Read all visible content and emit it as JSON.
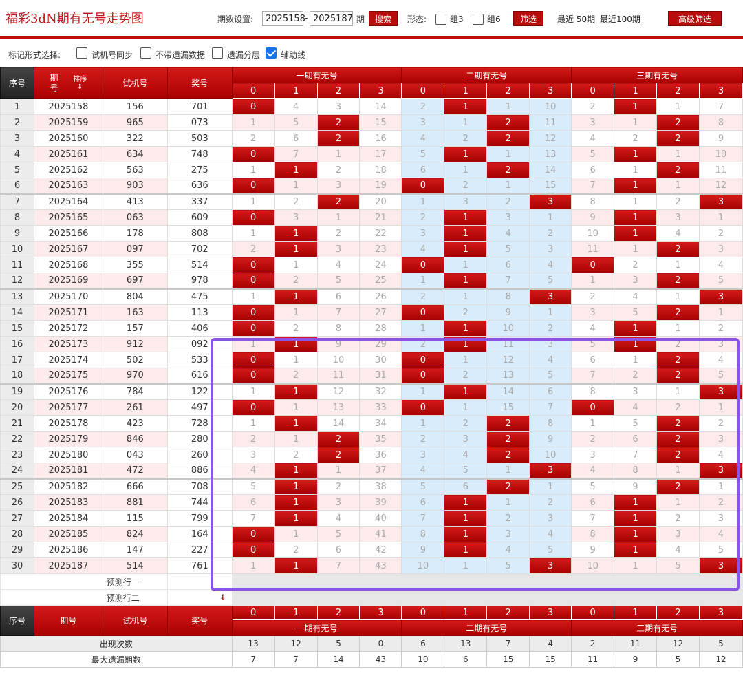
{
  "header": {
    "title": "福彩3dN期有无号走势图",
    "period_label": "期数设置:",
    "from_value": "2025158",
    "to_value": "2025187",
    "period_unit": "期",
    "search_label": "搜索",
    "form_label": "形态:",
    "group3_label": "组3",
    "group6_label": "组6",
    "filter_label": "筛选",
    "recent50_label": "最近 50期",
    "recent100_label": "最近100期",
    "advanced_label": "高级筛选"
  },
  "markbar": {
    "label": "标记形式选择:",
    "options": [
      {
        "label": "试机号同步",
        "checked": false
      },
      {
        "label": "不带遗漏数据",
        "checked": false
      },
      {
        "label": "遗漏分层",
        "checked": false
      },
      {
        "label": "辅助线",
        "checked": true
      }
    ]
  },
  "table": {
    "headers": {
      "seq": "序号",
      "period": "期号",
      "sort": "排序",
      "trial": "试机号",
      "prize": "奖号"
    },
    "groups": [
      "一期有无号",
      "二期有无号",
      "三期有无号"
    ],
    "digits": [
      "0",
      "1",
      "2",
      "3"
    ],
    "rows": [
      {
        "seq": "1",
        "period": "2025158",
        "trial": "156",
        "prize": "701",
        "g": [
          [
            0,
            4,
            3,
            14
          ],
          [
            2,
            1,
            1,
            10
          ],
          [
            2,
            1,
            1,
            7
          ]
        ],
        "h": [
          0,
          1,
          1
        ]
      },
      {
        "seq": "2",
        "period": "2025159",
        "trial": "965",
        "prize": "073",
        "g": [
          [
            1,
            5,
            2,
            15
          ],
          [
            3,
            1,
            2,
            11
          ],
          [
            3,
            1,
            2,
            8
          ]
        ],
        "h": [
          2,
          2,
          2
        ]
      },
      {
        "seq": "3",
        "period": "2025160",
        "trial": "322",
        "prize": "503",
        "g": [
          [
            2,
            6,
            2,
            16
          ],
          [
            4,
            2,
            2,
            12
          ],
          [
            4,
            2,
            2,
            9
          ]
        ],
        "h": [
          2,
          2,
          2
        ]
      },
      {
        "seq": "4",
        "period": "2025161",
        "trial": "634",
        "prize": "748",
        "g": [
          [
            0,
            7,
            1,
            17
          ],
          [
            5,
            1,
            1,
            13
          ],
          [
            5,
            1,
            1,
            10
          ]
        ],
        "h": [
          0,
          1,
          1
        ]
      },
      {
        "seq": "5",
        "period": "2025162",
        "trial": "563",
        "prize": "275",
        "g": [
          [
            1,
            1,
            2,
            18
          ],
          [
            6,
            1,
            2,
            14
          ],
          [
            6,
            1,
            2,
            11
          ]
        ],
        "h": [
          1,
          2,
          2
        ]
      },
      {
        "seq": "6",
        "period": "2025163",
        "trial": "903",
        "prize": "636",
        "g": [
          [
            0,
            1,
            3,
            19
          ],
          [
            0,
            2,
            1,
            15
          ],
          [
            7,
            1,
            1,
            12
          ]
        ],
        "h": [
          0,
          0,
          1
        ]
      },
      {
        "seq": "7",
        "period": "2025164",
        "trial": "413",
        "prize": "337",
        "g": [
          [
            1,
            2,
            2,
            20
          ],
          [
            1,
            3,
            2,
            3
          ],
          [
            8,
            1,
            2,
            3
          ]
        ],
        "h": [
          2,
          3,
          3
        ]
      },
      {
        "seq": "8",
        "period": "2025165",
        "trial": "063",
        "prize": "609",
        "g": [
          [
            0,
            3,
            1,
            21
          ],
          [
            2,
            1,
            3,
            1
          ],
          [
            9,
            1,
            3,
            1
          ]
        ],
        "h": [
          0,
          1,
          1
        ]
      },
      {
        "seq": "9",
        "period": "2025166",
        "trial": "178",
        "prize": "808",
        "g": [
          [
            1,
            1,
            2,
            22
          ],
          [
            3,
            1,
            4,
            2
          ],
          [
            10,
            1,
            4,
            2
          ]
        ],
        "h": [
          1,
          1,
          1
        ]
      },
      {
        "seq": "10",
        "period": "2025167",
        "trial": "097",
        "prize": "702",
        "g": [
          [
            2,
            1,
            3,
            23
          ],
          [
            4,
            1,
            5,
            3
          ],
          [
            11,
            1,
            2,
            3
          ]
        ],
        "h": [
          1,
          1,
          2
        ]
      },
      {
        "seq": "11",
        "period": "2025168",
        "trial": "355",
        "prize": "514",
        "g": [
          [
            0,
            1,
            4,
            24
          ],
          [
            0,
            1,
            6,
            4
          ],
          [
            0,
            2,
            1,
            4
          ]
        ],
        "h": [
          0,
          0,
          0
        ]
      },
      {
        "seq": "12",
        "period": "2025169",
        "trial": "697",
        "prize": "978",
        "g": [
          [
            0,
            2,
            5,
            25
          ],
          [
            1,
            1,
            7,
            5
          ],
          [
            1,
            3,
            2,
            5
          ]
        ],
        "h": [
          0,
          1,
          2
        ]
      },
      {
        "seq": "13",
        "period": "2025170",
        "trial": "804",
        "prize": "475",
        "g": [
          [
            1,
            1,
            6,
            26
          ],
          [
            2,
            1,
            8,
            3
          ],
          [
            2,
            4,
            1,
            3
          ]
        ],
        "h": [
          1,
          3,
          3
        ]
      },
      {
        "seq": "14",
        "period": "2025171",
        "trial": "163",
        "prize": "113",
        "g": [
          [
            0,
            1,
            7,
            27
          ],
          [
            0,
            2,
            9,
            1
          ],
          [
            3,
            5,
            2,
            1
          ]
        ],
        "h": [
          0,
          0,
          2
        ]
      },
      {
        "seq": "15",
        "period": "2025172",
        "trial": "157",
        "prize": "406",
        "g": [
          [
            0,
            2,
            8,
            28
          ],
          [
            1,
            1,
            10,
            2
          ],
          [
            4,
            1,
            1,
            2
          ]
        ],
        "h": [
          0,
          1,
          1
        ]
      },
      {
        "seq": "16",
        "period": "2025173",
        "trial": "912",
        "prize": "092",
        "g": [
          [
            1,
            1,
            9,
            29
          ],
          [
            2,
            1,
            11,
            3
          ],
          [
            5,
            1,
            2,
            3
          ]
        ],
        "h": [
          1,
          1,
          1
        ]
      },
      {
        "seq": "17",
        "period": "2025174",
        "trial": "502",
        "prize": "533",
        "g": [
          [
            0,
            1,
            10,
            30
          ],
          [
            0,
            1,
            12,
            4
          ],
          [
            6,
            1,
            2,
            4
          ]
        ],
        "h": [
          0,
          0,
          2
        ]
      },
      {
        "seq": "18",
        "period": "2025175",
        "trial": "970",
        "prize": "616",
        "g": [
          [
            0,
            2,
            11,
            31
          ],
          [
            0,
            2,
            13,
            5
          ],
          [
            7,
            2,
            2,
            5
          ]
        ],
        "h": [
          0,
          0,
          2
        ]
      },
      {
        "seq": "19",
        "period": "2025176",
        "trial": "784",
        "prize": "122",
        "g": [
          [
            1,
            1,
            12,
            32
          ],
          [
            1,
            1,
            14,
            6
          ],
          [
            8,
            3,
            1,
            3
          ]
        ],
        "h": [
          1,
          1,
          3
        ]
      },
      {
        "seq": "20",
        "period": "2025177",
        "trial": "261",
        "prize": "497",
        "g": [
          [
            0,
            1,
            13,
            33
          ],
          [
            0,
            1,
            15,
            7
          ],
          [
            0,
            4,
            2,
            1
          ]
        ],
        "h": [
          0,
          0,
          0
        ]
      },
      {
        "seq": "21",
        "period": "2025178",
        "trial": "423",
        "prize": "728",
        "g": [
          [
            1,
            1,
            14,
            34
          ],
          [
            1,
            2,
            2,
            8
          ],
          [
            1,
            5,
            2,
            2
          ]
        ],
        "h": [
          1,
          2,
          2
        ]
      },
      {
        "seq": "22",
        "period": "2025179",
        "trial": "846",
        "prize": "280",
        "g": [
          [
            2,
            1,
            2,
            35
          ],
          [
            2,
            3,
            2,
            9
          ],
          [
            2,
            6,
            2,
            3
          ]
        ],
        "h": [
          2,
          2,
          2
        ]
      },
      {
        "seq": "23",
        "period": "2025180",
        "trial": "043",
        "prize": "260",
        "g": [
          [
            3,
            2,
            2,
            36
          ],
          [
            3,
            4,
            2,
            10
          ],
          [
            3,
            7,
            2,
            4
          ]
        ],
        "h": [
          2,
          2,
          2
        ]
      },
      {
        "seq": "24",
        "period": "2025181",
        "trial": "472",
        "prize": "886",
        "g": [
          [
            4,
            1,
            1,
            37
          ],
          [
            4,
            5,
            1,
            3
          ],
          [
            4,
            8,
            1,
            3
          ]
        ],
        "h": [
          1,
          3,
          3
        ]
      },
      {
        "seq": "25",
        "period": "2025182",
        "trial": "666",
        "prize": "708",
        "g": [
          [
            5,
            1,
            2,
            38
          ],
          [
            5,
            6,
            2,
            1
          ],
          [
            5,
            9,
            2,
            1
          ]
        ],
        "h": [
          1,
          2,
          2
        ]
      },
      {
        "seq": "26",
        "period": "2025183",
        "trial": "881",
        "prize": "744",
        "g": [
          [
            6,
            1,
            3,
            39
          ],
          [
            6,
            1,
            1,
            2
          ],
          [
            6,
            1,
            1,
            2
          ]
        ],
        "h": [
          1,
          1,
          1
        ]
      },
      {
        "seq": "27",
        "period": "2025184",
        "trial": "115",
        "prize": "799",
        "g": [
          [
            7,
            1,
            4,
            40
          ],
          [
            7,
            1,
            2,
            3
          ],
          [
            7,
            1,
            2,
            3
          ]
        ],
        "h": [
          1,
          1,
          1
        ]
      },
      {
        "seq": "28",
        "period": "2025185",
        "trial": "824",
        "prize": "164",
        "g": [
          [
            0,
            1,
            5,
            41
          ],
          [
            8,
            1,
            3,
            4
          ],
          [
            8,
            1,
            3,
            4
          ]
        ],
        "h": [
          0,
          1,
          1
        ]
      },
      {
        "seq": "29",
        "period": "2025186",
        "trial": "147",
        "prize": "227",
        "g": [
          [
            0,
            2,
            6,
            42
          ],
          [
            9,
            1,
            4,
            5
          ],
          [
            9,
            1,
            4,
            5
          ]
        ],
        "h": [
          0,
          1,
          1
        ]
      },
      {
        "seq": "30",
        "period": "2025187",
        "trial": "514",
        "prize": "761",
        "g": [
          [
            1,
            1,
            7,
            43
          ],
          [
            10,
            1,
            5,
            3
          ],
          [
            10,
            1,
            5,
            3
          ]
        ],
        "h": [
          1,
          3,
          3
        ]
      }
    ],
    "predict1": "预测行一",
    "predict2": "预测行二",
    "stats": [
      {
        "label": "出现次数",
        "values": [
          "13",
          "12",
          "5",
          "0",
          "6",
          "13",
          "7",
          "4",
          "2",
          "11",
          "12",
          "5"
        ]
      },
      {
        "label": "最大遗漏期数",
        "values": [
          "7",
          "7",
          "14",
          "43",
          "10",
          "6",
          "15",
          "15",
          "11",
          "9",
          "5",
          "12"
        ]
      }
    ]
  },
  "colors": {
    "accent": "#b80d0d",
    "highlight": "#8a55e6",
    "mid_band": "#d8ecfb"
  }
}
